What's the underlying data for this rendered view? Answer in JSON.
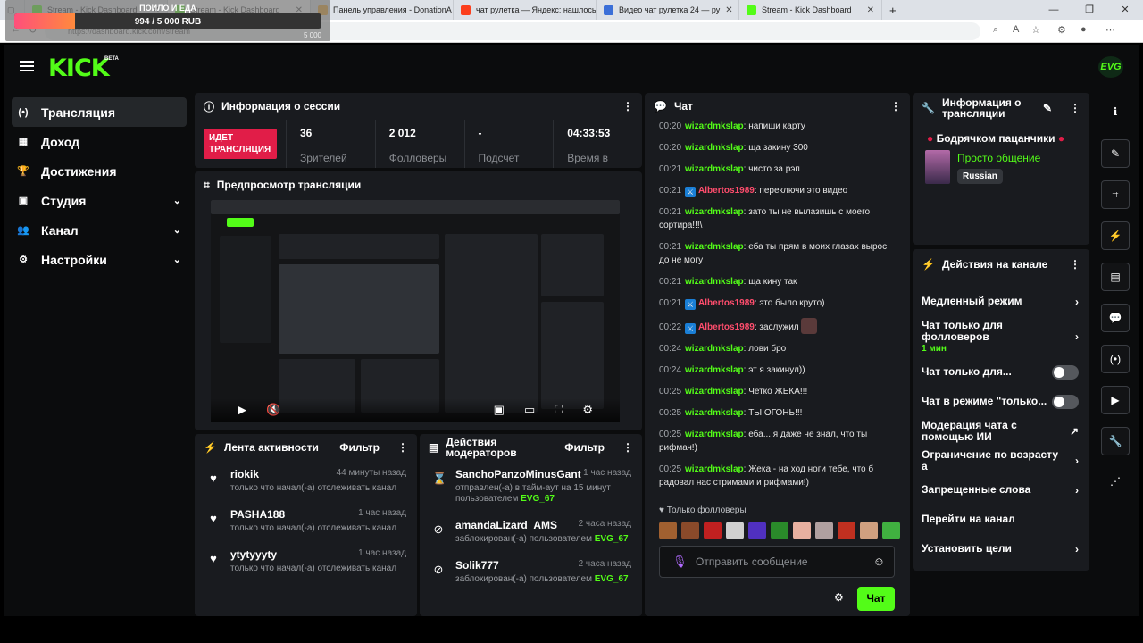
{
  "browser": {
    "tabs": [
      {
        "title": "Stream - Kick Dashboard",
        "color": "#53fc18",
        "active": false
      },
      {
        "title": "Stream - Kick Dashboard",
        "color": "#53fc18",
        "active": true
      },
      {
        "title": "Панель управления - DonationA",
        "color": "#f0a020",
        "active": false
      },
      {
        "title": "чат рулетка — Яндекс: нашлось",
        "color": "#fc3f1d",
        "active": false
      },
      {
        "title": "Видео чат рулетка 24 — ру",
        "color": "#3b6fd8",
        "active": false
      },
      {
        "title": "Stream - Kick Dashboard",
        "color": "#53fc18",
        "active": false
      }
    ],
    "url": "https://dashboard.kick.com/stream",
    "new_tab": "+",
    "win_controls": [
      "—",
      "❐",
      "✕"
    ]
  },
  "donation_overlay": {
    "title": "ПОИЛО И ЕДА",
    "amount": "994 / 5 000 RUB",
    "goal": "5 000",
    "progress": 0.199
  },
  "header": {
    "logo": "KICK",
    "beta": "BETA",
    "avatar": "EVG"
  },
  "sidebar": {
    "items": [
      {
        "label": "Трансляция",
        "icon": "broadcast-icon",
        "glyph": "(•)",
        "active": true,
        "chevron": false
      },
      {
        "label": "Доход",
        "icon": "income-icon",
        "glyph": "▦",
        "active": false,
        "chevron": false
      },
      {
        "label": "Достижения",
        "icon": "trophy-icon",
        "glyph": "🏆",
        "active": false,
        "chevron": false
      },
      {
        "label": "Студия",
        "icon": "studio-icon",
        "glyph": "▣",
        "active": false,
        "chevron": true
      },
      {
        "label": "Канал",
        "icon": "users-icon",
        "glyph": "👥",
        "active": false,
        "chevron": true
      },
      {
        "label": "Настройки",
        "icon": "gear-icon",
        "glyph": "⚙",
        "active": false,
        "chevron": true
      }
    ]
  },
  "session": {
    "title": "Информация о сессии",
    "live_label": "ИДЕТ ТРАНСЛЯЦИЯ",
    "stats": [
      {
        "value": "36",
        "label": "Зрителей"
      },
      {
        "value": "2 012",
        "label": "Фолловеры"
      },
      {
        "value": "-",
        "label": "Подсчет"
      },
      {
        "value": "04:33:53",
        "label": "Время в"
      }
    ]
  },
  "preview": {
    "title": "Предпросмотр трансляции"
  },
  "activity": {
    "title": "Лента активности",
    "filter": "Фильтр",
    "items": [
      {
        "user": "riokik",
        "time": "44 минуты назад",
        "desc": "только что начал(-а) отслеживать канал"
      },
      {
        "user": "PASHA188",
        "time": "1 час назад",
        "desc": "только что начал(-а) отслеживать канал"
      },
      {
        "user": "ytytyyyty",
        "time": "1 час назад",
        "desc": "только что начал(-а) отслеживать канал"
      }
    ]
  },
  "modactions": {
    "title": "Действия модераторов",
    "filter": "Фильтр",
    "items": [
      {
        "user": "SanchoPanzoMinusGant",
        "time": "1 час назад",
        "desc": "отправлен(-а) в тайм-аут на 15 минут пользователем",
        "by": "EVG_67",
        "icon": "hourglass-icon",
        "glyph": "⌛"
      },
      {
        "user": "amandaLizard_AMS",
        "time": "2 часа назад",
        "desc": "заблокирован(-а) пользователем",
        "by": "EVG_67",
        "icon": "ban-icon",
        "glyph": "⊘"
      },
      {
        "user": "Solik777",
        "time": "2 часа назад",
        "desc": "заблокирован(-а) пользователем",
        "by": "EVG_67",
        "icon": "ban-icon",
        "glyph": "⊘"
      }
    ]
  },
  "chat": {
    "title": "Чат",
    "messages": [
      {
        "time": "00:20",
        "user": "wizardmkslap",
        "text": "напиши карту",
        "mod": false
      },
      {
        "time": "00:20",
        "user": "wizardmkslap",
        "text": "ща закину 300",
        "mod": false
      },
      {
        "time": "00:21",
        "user": "wizardmkslap",
        "text": "чисто за рэп",
        "mod": false
      },
      {
        "time": "00:21",
        "user": "Albertos1989",
        "text": "переключи это видео",
        "mod": true
      },
      {
        "time": "00:21",
        "user": "wizardmkslap",
        "text": "зато ты не вылазишь с моего сортира!!!\\",
        "mod": false
      },
      {
        "time": "00:21",
        "user": "wizardmkslap",
        "text": "еба ты прям в моих глазах вырос до не могу",
        "mod": false
      },
      {
        "time": "00:21",
        "user": "wizardmkslap",
        "text": "ща кину так",
        "mod": false
      },
      {
        "time": "00:21",
        "user": "Albertos1989",
        "text": "это было круто)",
        "mod": true
      },
      {
        "time": "00:22",
        "user": "Albertos1989",
        "text": "заслужил",
        "mod": true,
        "emote": true
      },
      {
        "time": "00:24",
        "user": "wizardmkslap",
        "text": "лови бро",
        "mod": false
      },
      {
        "time": "00:24",
        "user": "wizardmkslap",
        "text": "эт я закинул))",
        "mod": false
      },
      {
        "time": "00:25",
        "user": "wizardmkslap",
        "text": "Четко ЖЕКА!!!",
        "mod": false
      },
      {
        "time": "00:25",
        "user": "wizardmkslap",
        "text": "ТЫ ОГОНЬ!!!",
        "mod": false
      },
      {
        "time": "00:25",
        "user": "wizardmkslap",
        "text": "еба... я даже не знал, что ты рифмач!)",
        "mod": false
      },
      {
        "time": "00:25",
        "user": "wizardmkslap",
        "text": "Жека - на ход ноги тебе, что б радовал нас стримами и рифмами!)",
        "mod": false
      }
    ],
    "followers_only": "Только фолловеры",
    "placeholder": "Отправить сообщение",
    "send_label": "Чат",
    "emote_colors": [
      "#a06030",
      "#8a4a2a",
      "#c02020",
      "#d0d0d0",
      "#5030c0",
      "#2a8a2a",
      "#e8b0a0",
      "#b0a0a0",
      "#c03020",
      "#d0a080",
      "#40b040"
    ]
  },
  "stream_info": {
    "title": "Информация о трансляции",
    "stream_title": "Бодрячком пацанчики",
    "category": "Просто общение",
    "language": "Russian"
  },
  "channel_actions": {
    "title": "Действия на канале",
    "items": [
      {
        "label": "Медленный режим",
        "sub": "",
        "type": "chevron"
      },
      {
        "label": "Чат только для фолловеров",
        "sub": "1 мин",
        "type": "chevron"
      },
      {
        "label": "Чат только для...",
        "sub": "",
        "type": "toggle"
      },
      {
        "label": "Чат в режиме \"только...",
        "sub": "",
        "type": "toggle"
      },
      {
        "label": "Модерация чата с помощью ИИ",
        "sub": "",
        "type": "external"
      },
      {
        "label": "Ограничение по возрасту а",
        "sub": "",
        "type": "chevron"
      },
      {
        "label": "Запрещенные слова",
        "sub": "",
        "type": "chevron"
      },
      {
        "label": "Перейти на канал",
        "sub": "",
        "type": "none"
      },
      {
        "label": "Установить цели",
        "sub": "",
        "type": "chevron"
      }
    ]
  },
  "rail": [
    {
      "icon": "info-icon",
      "glyph": "ℹ",
      "plain": true
    },
    {
      "icon": "edit-icon",
      "glyph": "✎",
      "plain": false
    },
    {
      "icon": "scan-icon",
      "glyph": "⌗",
      "plain": false
    },
    {
      "icon": "bolt-icon",
      "glyph": "⚡",
      "plain": false
    },
    {
      "icon": "document-icon",
      "glyph": "▤",
      "plain": false
    },
    {
      "icon": "chat-icon",
      "glyph": "💬",
      "plain": false
    },
    {
      "icon": "broadcast-icon",
      "glyph": "(•)",
      "plain": false
    },
    {
      "icon": "video-icon",
      "glyph": "▶",
      "plain": false
    },
    {
      "icon": "wrench-icon",
      "glyph": "🔧",
      "plain": false
    },
    {
      "icon": "share-icon",
      "glyph": "⋰",
      "plain": true
    }
  ]
}
